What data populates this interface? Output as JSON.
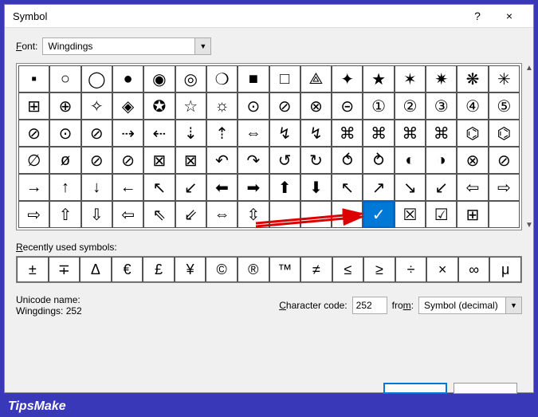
{
  "window": {
    "title": "Symbol",
    "help": "?",
    "close": "×"
  },
  "font": {
    "label": "Font:",
    "value": "Wingdings"
  },
  "grid": {
    "rows": [
      [
        "▪",
        "○",
        "◯",
        "●",
        "◉",
        "◎",
        "❍",
        "■",
        "□",
        "⟁",
        "✦",
        "★",
        "✶",
        "✷",
        "❋",
        "✳"
      ],
      [
        "⊞",
        "⊕",
        "✧",
        "◈",
        "✪",
        "☆",
        "☼",
        "⊙",
        "⊘",
        "⊗",
        "⊝",
        "①",
        "②",
        "③",
        "④",
        "⑤"
      ],
      [
        "⊘",
        "⊙",
        "⊘",
        "⇢",
        "⇠",
        "⇣",
        "⇡",
        "⇔",
        "↯",
        "↯",
        "⌘",
        "⌘",
        "⌘",
        "⌘",
        "⌬",
        "⌬"
      ],
      [
        "∅",
        "ø",
        "⊘",
        "⊘",
        "⊠",
        "⊠",
        "↶",
        "↷",
        "↺",
        "↻",
        "⥀",
        "⥁",
        "◐",
        "◑",
        "⊗",
        "⊘"
      ],
      [
        "→",
        "↑",
        "↓",
        "←",
        "↖",
        "↙",
        "⬅",
        "➡",
        "⬆",
        "⬇",
        "↖",
        "↗",
        "↘",
        "↙",
        "⇦",
        "⇨"
      ],
      [
        "⇨",
        "⇧",
        "⇩",
        "⇦",
        "⇖",
        "⇙",
        "⇔",
        "⇳",
        "",
        "",
        "",
        "✓",
        "☒",
        "☑",
        "⊞",
        ""
      ]
    ],
    "selected": {
      "row": 5,
      "col": 11
    }
  },
  "recent": {
    "label": "Recently used symbols:",
    "items": [
      "±",
      "∓",
      "Δ",
      "€",
      "£",
      "¥",
      "©",
      "®",
      "™",
      "≠",
      "≤",
      "≥",
      "÷",
      "×",
      "∞",
      "μ"
    ]
  },
  "info": {
    "unicode_label": "Unicode name:",
    "unicode_value": "Wingdings: 252",
    "charcode_label": "Character code:",
    "charcode_value": "252",
    "from_label": "from:",
    "from_value": "Symbol (decimal)"
  },
  "branding": "TipsMake"
}
